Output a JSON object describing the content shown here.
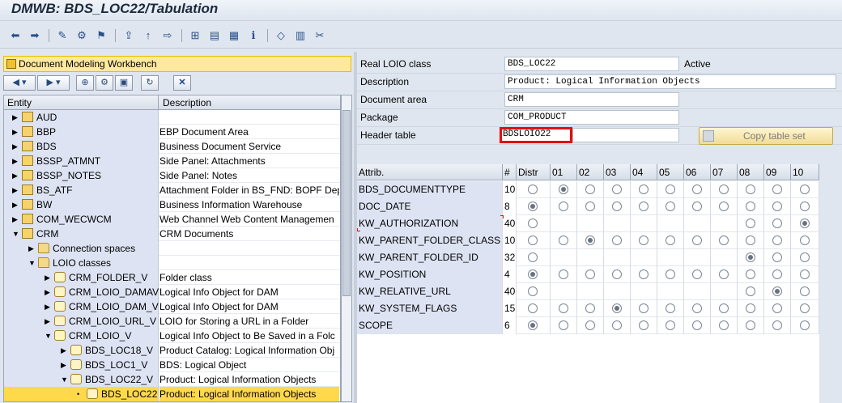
{
  "window": {
    "title": "DMWB: BDS_LOC22/Tabulation"
  },
  "toolbar": {
    "icons": [
      "back-arrow-icon",
      "forward-arrow-icon",
      "edit-pencil-icon",
      "display-change-icon",
      "activate-icon",
      "hierarchy-up-icon",
      "where-used-icon",
      "navigate-icon",
      "tree-structure-icon",
      "print-icon",
      "layout-icon",
      "info-icon",
      "tag-icon",
      "table-icon",
      "tools-icon"
    ]
  },
  "left": {
    "title": "Document Modeling Workbench",
    "columns": {
      "entity": "Entity",
      "description": "Description"
    },
    "rows": [
      {
        "label": "AUD",
        "desc": "",
        "level": 0,
        "icon": "box"
      },
      {
        "label": "BBP",
        "desc": "EBP Document Area",
        "level": 0,
        "icon": "box"
      },
      {
        "label": "BDS",
        "desc": "Business Document Service",
        "level": 0,
        "icon": "box"
      },
      {
        "label": "BSSP_ATMNT",
        "desc": "Side Panel: Attachments",
        "level": 0,
        "icon": "box"
      },
      {
        "label": "BSSP_NOTES",
        "desc": "Side Panel: Notes",
        "level": 0,
        "icon": "box"
      },
      {
        "label": "BS_ATF",
        "desc": "Attachment Folder in BS_FND: BOPF Dep",
        "level": 0,
        "icon": "box"
      },
      {
        "label": "BW",
        "desc": "Business Information Warehouse",
        "level": 0,
        "icon": "box"
      },
      {
        "label": "COM_WECWCM",
        "desc": "Web Channel Web Content Managemen",
        "level": 0,
        "icon": "box"
      },
      {
        "label": "CRM",
        "desc": "CRM Documents",
        "level": 0,
        "icon": "box",
        "open": true
      },
      {
        "label": "Connection spaces",
        "desc": "",
        "level": 1,
        "icon": "folder"
      },
      {
        "label": "LOIO classes",
        "desc": "",
        "level": 1,
        "icon": "folder",
        "open": true
      },
      {
        "label": "CRM_FOLDER_V",
        "desc": "Folder class",
        "level": 2,
        "icon": "doc"
      },
      {
        "label": "CRM_LOIO_DAMAV",
        "desc": "Logical Info Object for DAM",
        "level": 2,
        "icon": "doc"
      },
      {
        "label": "CRM_LOIO_DAM_V",
        "desc": "Logical Info Object for DAM",
        "level": 2,
        "icon": "doc"
      },
      {
        "label": "CRM_LOIO_URL_V",
        "desc": "LOIO for Storing a URL in a Folder",
        "level": 2,
        "icon": "doc"
      },
      {
        "label": "CRM_LOIO_V",
        "desc": "Logical Info Object to Be Saved in a Folc",
        "level": 2,
        "icon": "doc",
        "open": true
      },
      {
        "label": "BDS_LOC18_V",
        "desc": "Product Catalog: Logical Information Obj",
        "level": 3,
        "icon": "doc"
      },
      {
        "label": "BDS_LOC1_V",
        "desc": "BDS: Logical Object",
        "level": 3,
        "icon": "doc"
      },
      {
        "label": "BDS_LOC22_V",
        "desc": "Product: Logical Information Objects",
        "level": 3,
        "icon": "doc",
        "open": true
      },
      {
        "label": "BDS_LOC22",
        "desc": "Product: Logical Information Objects",
        "level": 4,
        "icon": "doc",
        "selected": true,
        "leaf": true
      }
    ]
  },
  "right": {
    "fields": [
      {
        "label": "Real LOIO class",
        "value": "BDS_LOC22",
        "extra": "Active"
      },
      {
        "label": "Description",
        "value": "Product: Logical Information Objects"
      },
      {
        "label": "Document area",
        "value": "CRM"
      },
      {
        "label": "Package",
        "value": "COM_PRODUCT"
      },
      {
        "label": "Header table",
        "value": "BDSLOIO22",
        "highlight": true
      }
    ],
    "copy_button": "Copy table set",
    "grid": {
      "headers": [
        "Attrib.",
        "#",
        "Distr",
        "01",
        "02",
        "03",
        "04",
        "05",
        "06",
        "07",
        "08",
        "09",
        "10"
      ],
      "rows": [
        {
          "attr": "BDS_DOCUMENTTYPE",
          "num": "10",
          "radios": [
            0,
            1,
            0,
            0,
            0,
            0,
            0,
            0,
            0,
            0,
            0
          ]
        },
        {
          "attr": "DOC_DATE",
          "num": "8",
          "radios": [
            1,
            0,
            0,
            0,
            0,
            0,
            0,
            0,
            0,
            0,
            0
          ]
        },
        {
          "attr": "KW_AUTHORIZATION",
          "num": "40",
          "radios": [
            0,
            null,
            null,
            null,
            null,
            null,
            null,
            null,
            0,
            0,
            1
          ]
        },
        {
          "attr": "KW_PARENT_FOLDER_CLASS",
          "num": "10",
          "radios": [
            0,
            0,
            1,
            0,
            0,
            0,
            0,
            0,
            0,
            0,
            0
          ]
        },
        {
          "attr": "KW_PARENT_FOLDER_ID",
          "num": "32",
          "radios": [
            0,
            null,
            null,
            null,
            null,
            null,
            null,
            null,
            1,
            0,
            0
          ]
        },
        {
          "attr": "KW_POSITION",
          "num": "4",
          "radios": [
            1,
            0,
            0,
            0,
            0,
            0,
            0,
            0,
            0,
            0,
            0
          ]
        },
        {
          "attr": "KW_RELATIVE_URL",
          "num": "40",
          "radios": [
            0,
            null,
            null,
            null,
            null,
            null,
            null,
            null,
            0,
            1,
            0
          ]
        },
        {
          "attr": "KW_SYSTEM_FLAGS",
          "num": "15",
          "radios": [
            0,
            0,
            0,
            1,
            0,
            0,
            0,
            0,
            0,
            0,
            0
          ]
        },
        {
          "attr": "SCOPE",
          "num": "6",
          "radios": [
            1,
            0,
            0,
            0,
            0,
            0,
            0,
            0,
            0,
            0,
            0
          ]
        }
      ]
    }
  }
}
